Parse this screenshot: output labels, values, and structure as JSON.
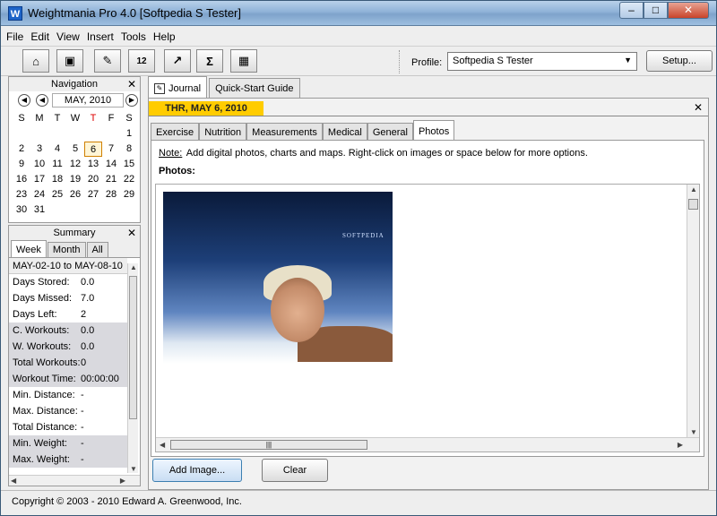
{
  "window": {
    "title": "Weightmania Pro 4.0 [Softpedia S Tester]",
    "icon_letter": "W"
  },
  "menu": [
    "File",
    "Edit",
    "View",
    "Insert",
    "Tools",
    "Help"
  ],
  "toolbar": {
    "buttons": [
      {
        "name": "home-icon",
        "glyph": "⌂"
      },
      {
        "name": "save-icon",
        "glyph": "▣"
      },
      {
        "name": "edit-icon",
        "glyph": "✎"
      },
      {
        "name": "calendar-icon",
        "glyph": "12"
      },
      {
        "name": "chart-icon",
        "glyph": "↗"
      },
      {
        "name": "sum-icon",
        "glyph": "Σ"
      },
      {
        "name": "calculator-icon",
        "glyph": "▦"
      }
    ],
    "profile_label": "Profile:",
    "profile_value": "Softpedia S Tester",
    "setup_label": "Setup..."
  },
  "navigation": {
    "title": "Navigation",
    "month": "MAY, 2010",
    "weekdays": [
      "S",
      "M",
      "T",
      "W",
      "T",
      "F",
      "S"
    ],
    "days": [
      "",
      "",
      "",
      "",
      "",
      "",
      "1",
      "2",
      "3",
      "4",
      "5",
      "6",
      "7",
      "8",
      "9",
      "10",
      "11",
      "12",
      "13",
      "14",
      "15",
      "16",
      "17",
      "18",
      "19",
      "20",
      "21",
      "22",
      "23",
      "24",
      "25",
      "26",
      "27",
      "28",
      "29",
      "30",
      "31"
    ],
    "today": "6"
  },
  "summary": {
    "title": "Summary",
    "tabs": [
      "Week",
      "Month",
      "All"
    ],
    "range": "MAY-02-10 to MAY-08-10",
    "rows": [
      {
        "label": "Days Stored:",
        "value": "0.0"
      },
      {
        "label": "Days Missed:",
        "value": "7.0"
      },
      {
        "label": "Days Left:",
        "value": "2"
      },
      {
        "label": "C. Workouts:",
        "value": "0.0"
      },
      {
        "label": "W. Workouts:",
        "value": "0.0"
      },
      {
        "label": "Total Workouts:",
        "value": "0"
      },
      {
        "label": "Workout Time:",
        "value": "00:00:00"
      },
      {
        "label": "Min. Distance:",
        "value": "-"
      },
      {
        "label": "Max. Distance:",
        "value": "-"
      },
      {
        "label": "Total Distance:",
        "value": "-"
      },
      {
        "label": "Min. Weight:",
        "value": "-"
      },
      {
        "label": "Max. Weight:",
        "value": "-"
      }
    ]
  },
  "main_tabs": [
    "Journal",
    "Quick-Start Guide"
  ],
  "journal": {
    "date": "THR, MAY 6, 2010",
    "sub_tabs": [
      "Exercise",
      "Nutrition",
      "Measurements",
      "Medical",
      "General",
      "Photos"
    ],
    "note_label": "Note:",
    "note_text": "Add digital photos, charts and maps.  Right-click on images or space below for more options.",
    "photos_label": "Photos:",
    "photo_logo": "SOFTPEDIA",
    "add_image_label": "Add Image...",
    "clear_label": "Clear"
  },
  "status": {
    "copyright": "Copyright © 2003 - 2010 Edward A. Greenwood, Inc."
  }
}
